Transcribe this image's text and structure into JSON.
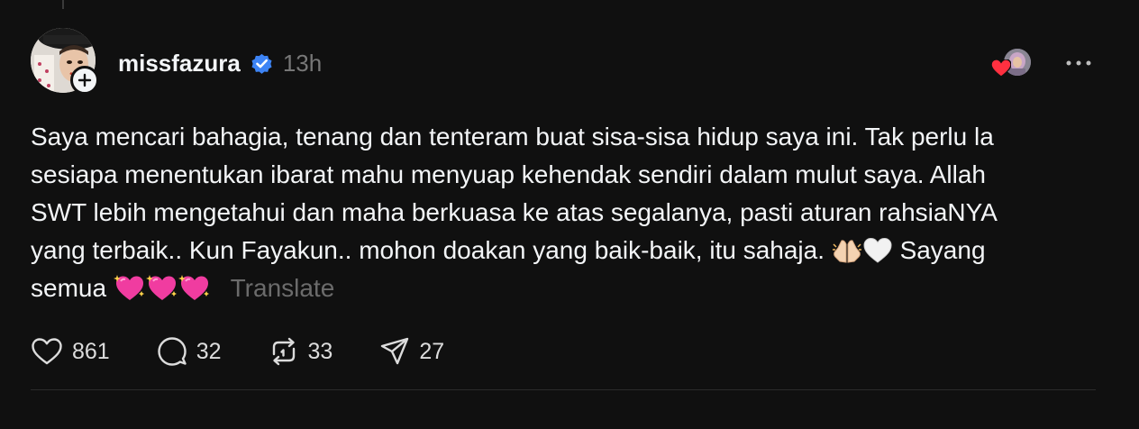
{
  "post": {
    "username": "missfazura",
    "time": "13h",
    "verified_color": "#3d84f5",
    "lines": [
      "Saya mencari bahagia, tenang dan tenteram buat sisa-sisa hidup saya ini. Tak perlu la",
      "sesiapa menentukan ibarat mahu menyuap kehendak sendiri dalam mulut saya. Allah",
      "SWT lebih mengetahui dan maha berkuasa ke atas segalanya, pasti aturan rahsiaNYA",
      "yang terbaik.. Kun Fayakun.. mohon doakan yang baik-baik, itu sahaja.",
      "Sayang",
      "semua"
    ],
    "translate_label": "Translate",
    "icons": {
      "praying": "praying-hands-emoji",
      "white_heart": "white-heart-emoji",
      "sparkling_heart": "sparkling-heart-emoji"
    }
  },
  "actions": {
    "likes": "861",
    "comments": "32",
    "reposts": "33",
    "shares": "27"
  }
}
